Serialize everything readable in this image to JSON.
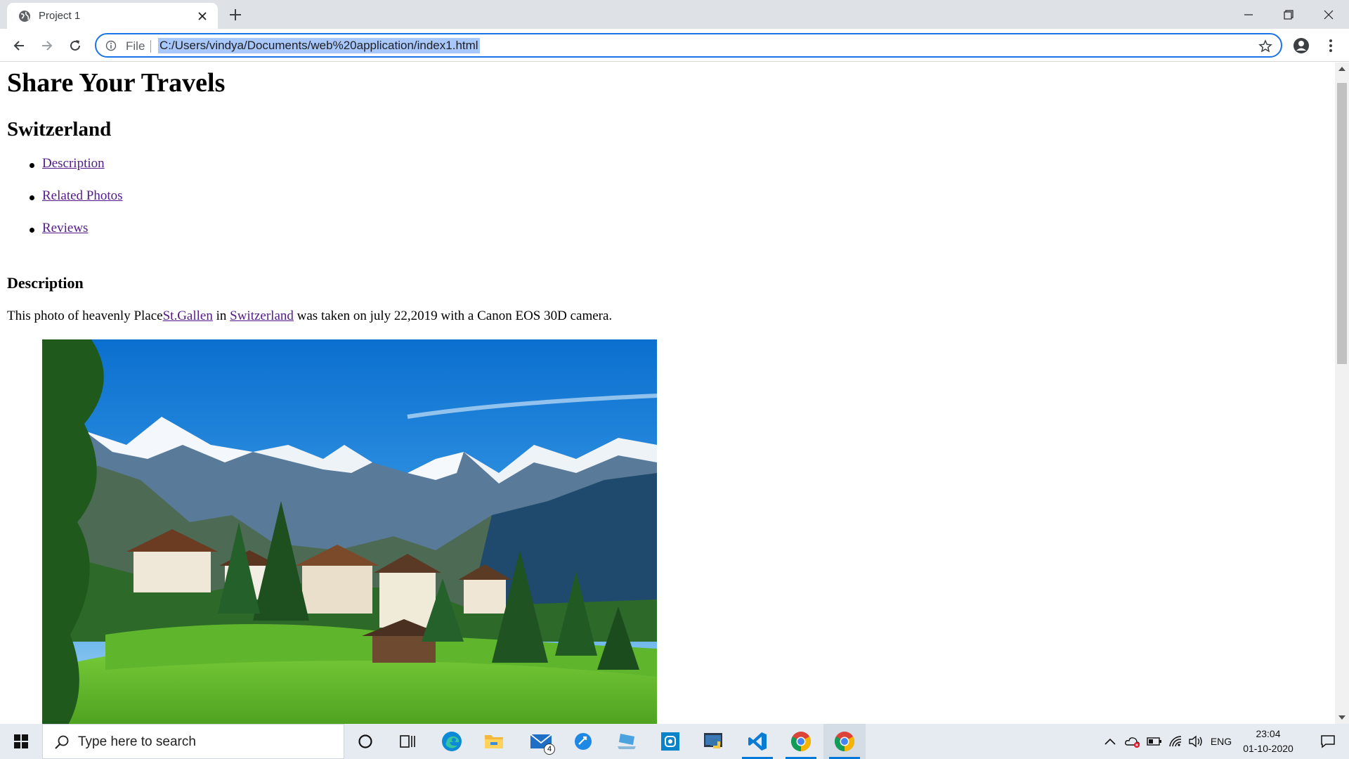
{
  "browser": {
    "tab_title": "Project 1",
    "omnibox": {
      "scheme_label": "File",
      "url": "C:/Users/vindya/Documents/web%20application/index1.html"
    }
  },
  "page": {
    "title": "Share Your Travels",
    "country": "Switzerland",
    "nav": [
      "Description",
      "Related Photos",
      "Reviews"
    ],
    "section_title": "Description",
    "description": {
      "prefix": "This photo of heavenly Place",
      "link_city": "St.Gallen",
      "in_word": " in ",
      "link_country": "Switzerland",
      "suffix": " was taken on july 22,2019 with a Canon EOS 30D camera."
    },
    "photo_alt": "Swiss alpine village"
  },
  "taskbar": {
    "search_placeholder": "Type here to search",
    "mail_badge": "4",
    "language": "ENG",
    "time": "23:04",
    "date": "01-10-2020"
  },
  "colors": {
    "link": "#551a8b",
    "accent": "#1a73e8",
    "url_highlight": "#a8c7fa",
    "taskbar_bg": "#e6ebf1"
  }
}
